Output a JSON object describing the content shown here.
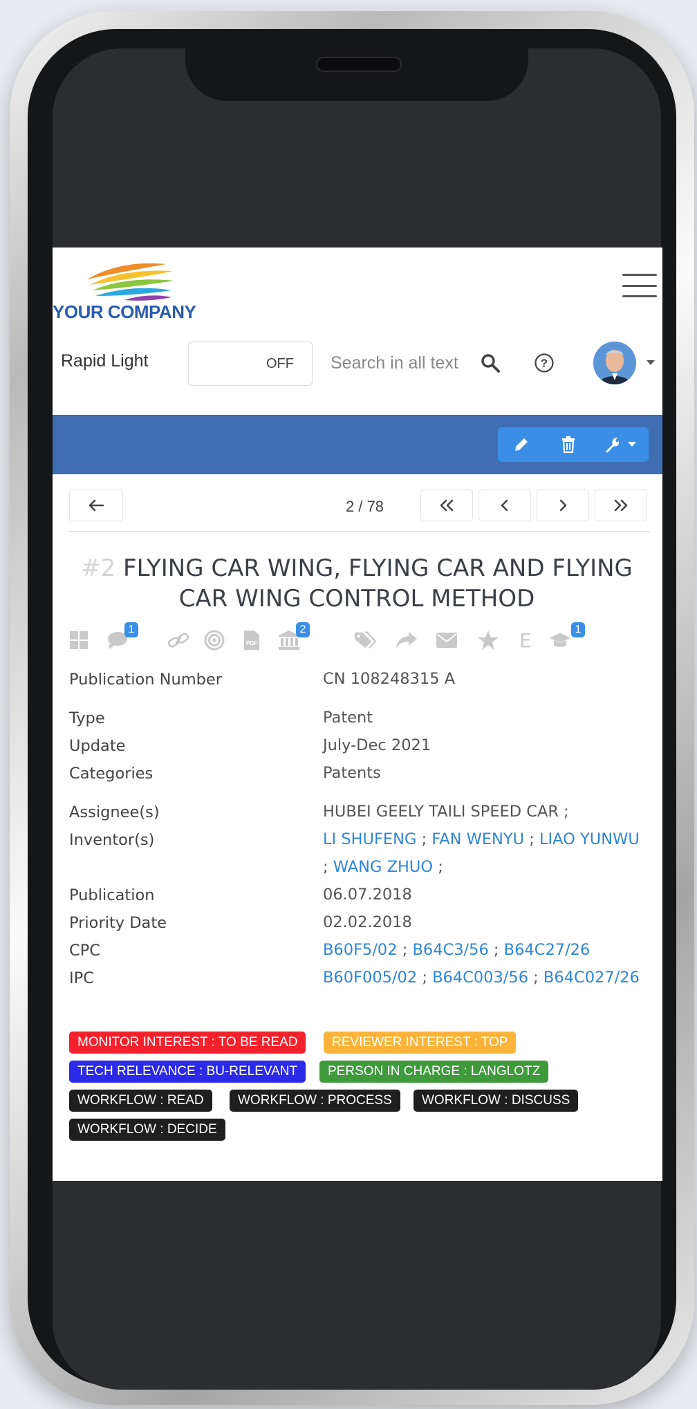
{
  "app": {
    "logo_text": "YOUR COMPANY",
    "rapid_light_label": "Rapid Light",
    "toggle_state": "OFF",
    "search_placeholder": "Search in all text",
    "help_symbol": "?"
  },
  "pager": {
    "label": "2 / 78"
  },
  "record": {
    "number": "#2",
    "title": "FLYING CAR WING, FLYING CAR AND FLYING CAR WING CONTROL METHOD"
  },
  "icon_row": [
    {
      "name": "grid-icon",
      "badge": ""
    },
    {
      "name": "comment-icon",
      "badge": "1"
    },
    {
      "name": "link-icon",
      "badge": ""
    },
    {
      "name": "target-icon",
      "badge": ""
    },
    {
      "name": "pdf-icon",
      "badge": ""
    },
    {
      "name": "institution-icon",
      "badge": "2"
    },
    {
      "name": "tags-icon",
      "badge": ""
    },
    {
      "name": "share-icon",
      "badge": ""
    },
    {
      "name": "envelope-icon",
      "badge": ""
    },
    {
      "name": "star-icon",
      "badge": ""
    },
    {
      "name": "letter-e-icon",
      "badge": "",
      "text": "E"
    },
    {
      "name": "graduation-cap-icon",
      "badge": "1"
    }
  ],
  "fields": {
    "publication_number": {
      "label": "Publication Number",
      "value": "CN 108248315 A"
    },
    "type": {
      "label": "Type",
      "value": "Patent"
    },
    "update": {
      "label": "Update",
      "value": "July-Dec 2021"
    },
    "categories": {
      "label": "Categories",
      "value": "Patents"
    },
    "assignees": {
      "label": "Assignee(s)",
      "value": "HUBEI GEELY TAILI SPEED CAR ;"
    },
    "inventors": {
      "label": "Inventor(s)",
      "links": [
        "LI SHUFENG",
        "FAN WENYU",
        "LIAO YUNWU",
        "WANG ZHUO"
      ],
      "sep": ";"
    },
    "publication": {
      "label": "Publication",
      "value": "06.07.2018"
    },
    "priority_date": {
      "label": "Priority Date",
      "value": "02.02.2018"
    },
    "cpc": {
      "label": "CPC",
      "links": [
        "B60F5/02",
        "B64C3/56",
        "B64C27/26"
      ]
    },
    "ipc": {
      "label": "IPC",
      "links": [
        "B60F005/02",
        "B64C003/56",
        "B64C027/26"
      ]
    }
  },
  "tags": [
    {
      "text": "MONITOR INTEREST : TO BE READ",
      "color": "#f5222d"
    },
    {
      "text": "REVIEWER INTEREST : TOP",
      "color": "#fbb33a"
    },
    {
      "text": "TECH RELEVANCE : BU-RELEVANT",
      "color": "#2a2ae8"
    },
    {
      "text": "PERSON IN CHARGE : LANGLOTZ",
      "color": "#3e9a3a"
    },
    {
      "text": "WORKFLOW : READ",
      "color": "#1f1f1f"
    },
    {
      "text": "WORKFLOW : PROCESS",
      "color": "#1f1f1f"
    },
    {
      "text": "WORKFLOW : DISCUSS",
      "color": "#1f1f1f"
    },
    {
      "text": "WORKFLOW : DECIDE",
      "color": "#1f1f1f"
    }
  ],
  "colors": {
    "header_bar": "#3f6eb3",
    "action_buttons": "#3a8ee6",
    "link": "#2f86d8"
  }
}
